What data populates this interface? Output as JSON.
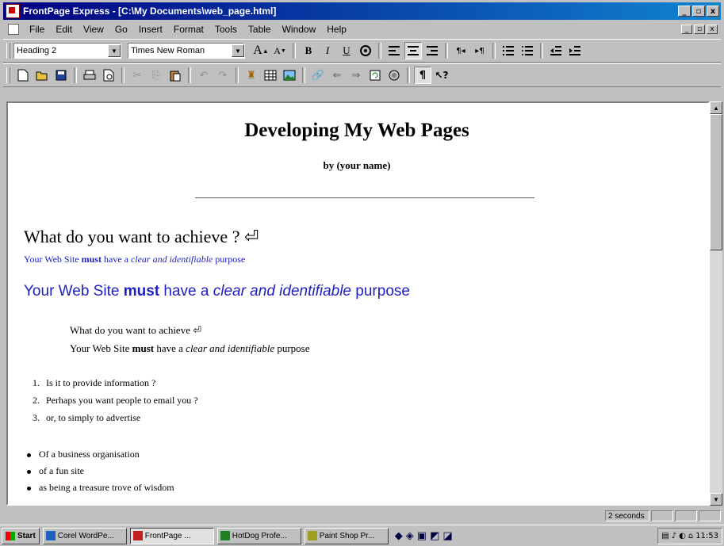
{
  "window": {
    "title": "FrontPage Express - [C:\\My Documents\\web_page.html]",
    "controls": [
      "_",
      "▫",
      "x"
    ]
  },
  "menubar": {
    "items": [
      "File",
      "Edit",
      "View",
      "Go",
      "Insert",
      "Format",
      "Tools",
      "Table",
      "Window",
      "Help"
    ],
    "doc_controls": [
      "_",
      "▫",
      "x"
    ]
  },
  "format_toolbar": {
    "style_value": "Heading 2",
    "font_value": "Times New Roman",
    "buttons": [
      "A↑",
      "A↓",
      "B",
      "I",
      "U",
      "color",
      "align-left",
      "align-center",
      "align-right",
      "ltr",
      "rtl",
      "numbered-list",
      "bulleted-list",
      "decrease-indent",
      "increase-indent"
    ]
  },
  "standard_toolbar": {
    "buttons": [
      "new",
      "open",
      "save",
      "print",
      "print-preview",
      "cut",
      "copy",
      "paste",
      "undo",
      "redo",
      "insert-webbot",
      "insert-table",
      "insert-image",
      "hyperlink",
      "back",
      "forward",
      "refresh",
      "stop",
      "show-formatting",
      "help"
    ]
  },
  "document": {
    "heading": "Developing My Web Pages",
    "byline": "by (your name)",
    "section_heading": "What do you want to achieve ? ⏎",
    "blue_small": {
      "part1": "Your Web Site ",
      "bold": "must",
      "part2": " have a ",
      "italic": "clear and identifiable",
      "part3": " purpose"
    },
    "blue_big": {
      "part1": "Your Web Site ",
      "bold": "must",
      "part2": " have a ",
      "italic": "clear and identifiable",
      "part3": " purpose"
    },
    "indent_line1": "What do you want to achieve ⏎",
    "indent_line2": {
      "part1": "Your Web Site ",
      "bold": "must",
      "part2": " have a ",
      "italic": "clear and identifiable",
      "part3": " purpose"
    },
    "ordered_list": [
      {
        "num": "1.",
        "text": "Is it to provide information ?"
      },
      {
        "num": "2.",
        "text": "Perhaps you want people to email you ?"
      },
      {
        "num": "3.",
        "text": "or, to simply to advertise"
      }
    ],
    "bullet_list": [
      "Of a business organisation",
      "of a fun site",
      "as being a treasure trove of wisdom"
    ]
  },
  "statusbar": {
    "load_time": "2 seconds"
  },
  "taskbar": {
    "start_label": "Start",
    "tasks": [
      {
        "label": "Corel WordPe...",
        "active": false
      },
      {
        "label": "FrontPage ...",
        "active": true
      },
      {
        "label": "HotDog Profe...",
        "active": false
      },
      {
        "label": "Paint Shop Pr...",
        "active": false
      }
    ],
    "clock": "11:53"
  },
  "colors": {
    "title_gradient_start": "#000080",
    "title_gradient_end": "#1084d0",
    "doc_blue_text": "#2020c0",
    "chrome": "#c0c0c0"
  }
}
